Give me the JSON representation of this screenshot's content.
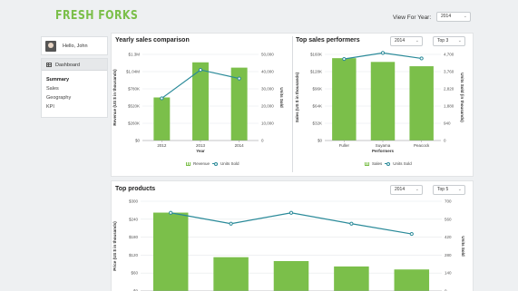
{
  "brand": {
    "logo_text": "FRESH FORKS",
    "accent": "#7bbf4a",
    "line_color": "#2a8a99"
  },
  "header": {
    "year_label": "View For Year:",
    "year_value": "2014"
  },
  "sidebar": {
    "greeting": "Hello, John",
    "section": "Dashboard",
    "items": [
      {
        "label": "Summary",
        "active": true
      },
      {
        "label": "Sales",
        "active": false
      },
      {
        "label": "Geography",
        "active": false
      },
      {
        "label": "KPI",
        "active": false
      }
    ]
  },
  "panels": {
    "yearly": {
      "title": "Yearly sales comparison"
    },
    "performers": {
      "title": "Top sales performers",
      "year_select": "2014",
      "top_select": "Top 3"
    },
    "products": {
      "title": "Top products",
      "year_select": "2014",
      "top_select": "Top 5"
    }
  },
  "chart_data": [
    {
      "type": "bar",
      "title": "Yearly sales comparison",
      "xlabel": "Year",
      "ylabel": "Revenue (US $ in thousands)",
      "y2label": "Units Sold",
      "categories": [
        "2012",
        "2013",
        "2014"
      ],
      "y_ticks": [
        "$0",
        "$260K",
        "$520K",
        "$780K",
        "$1.04M",
        "$1.3M"
      ],
      "y2_ticks": [
        "0",
        "10,000",
        "20,000",
        "30,000",
        "40,000",
        "50,000"
      ],
      "ylim": [
        0,
        1300000
      ],
      "y2lim": [
        0,
        50000
      ],
      "series": [
        {
          "name": "Revenue",
          "type": "bar",
          "values": [
            650000,
            1180000,
            1100000
          ]
        },
        {
          "name": "Units Sold",
          "type": "line",
          "axis": "y2",
          "values": [
            24500,
            41000,
            36000
          ]
        }
      ],
      "legend": "bottom"
    },
    {
      "type": "bar",
      "title": "Top sales performers",
      "xlabel": "Performers",
      "ylabel": "Sales (US $ in thousands)",
      "y2label": "Units Sold (in thousands)",
      "categories": [
        "Fuller",
        "Suyama",
        "Peacock"
      ],
      "y_ticks": [
        "$0",
        "$32K",
        "$64K",
        "$96K",
        "$128K",
        "$160K"
      ],
      "y2_ticks": [
        "0",
        "940",
        "1,880",
        "2,820",
        "3,760",
        "4,700"
      ],
      "ylim": [
        0,
        160000
      ],
      "y2lim": [
        0,
        4700
      ],
      "series": [
        {
          "name": "Sales",
          "type": "bar",
          "values": [
            153000,
            146000,
            138000
          ]
        },
        {
          "name": "Units Sold",
          "type": "line",
          "axis": "y2",
          "values": [
            4450,
            4780,
            4480
          ]
        }
      ],
      "legend": "bottom"
    },
    {
      "type": "bar",
      "title": "Top products",
      "ylabel": "Price (US $ in thousands)",
      "y2label": "Units Sold",
      "categories": [
        "",
        "",
        "",
        "",
        ""
      ],
      "y_ticks": [
        "$0",
        "$60",
        "$120",
        "$180",
        "$240",
        "$300"
      ],
      "y2_ticks": [
        "0",
        "140",
        "280",
        "420",
        "560",
        "700"
      ],
      "ylim": [
        0,
        300
      ],
      "y2lim": [
        0,
        700
      ],
      "series": [
        {
          "name": "Price",
          "type": "bar",
          "values": [
            262,
            113,
            100,
            82,
            72
          ]
        },
        {
          "name": "Units Sold",
          "type": "line",
          "axis": "y2",
          "values": [
            610,
            525,
            610,
            525,
            445
          ]
        }
      ],
      "legend": "none"
    }
  ]
}
